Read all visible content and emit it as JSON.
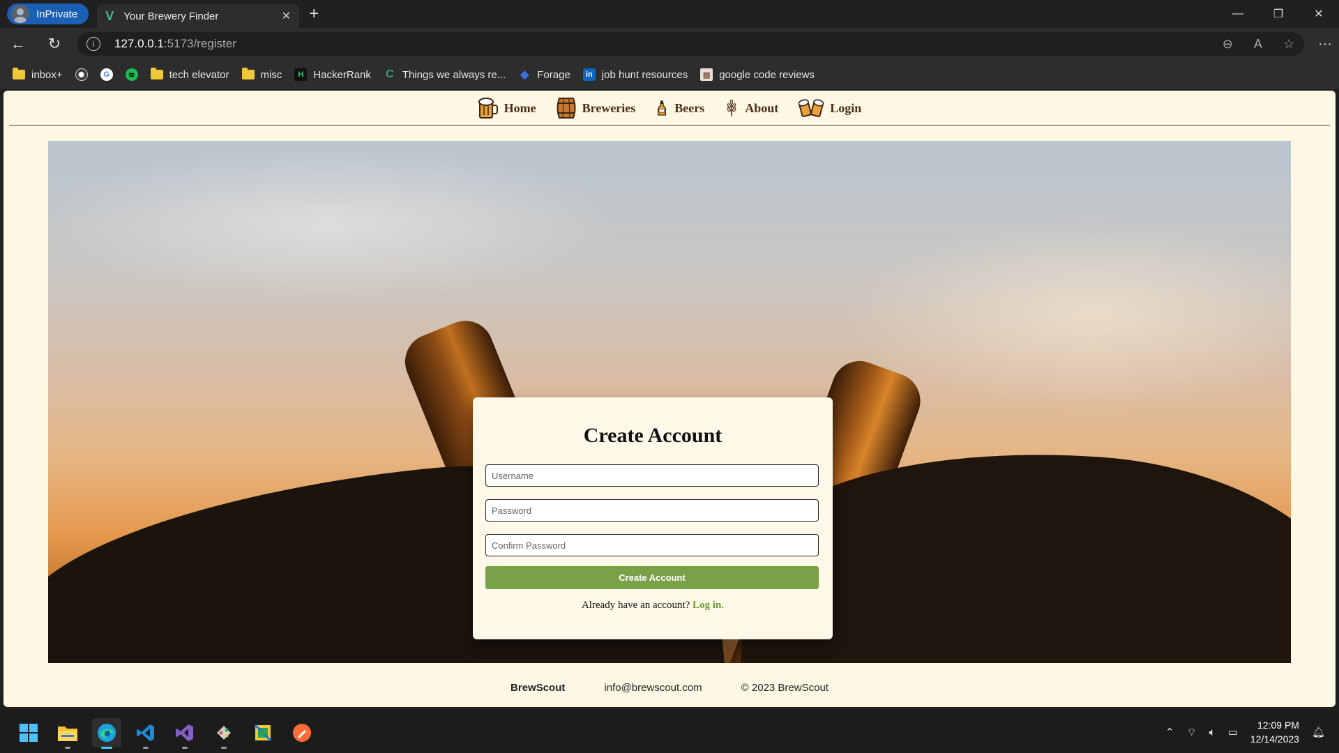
{
  "browser": {
    "profile_label": "InPrivate",
    "tab_title": "Your Brewery Finder",
    "url_host": "127.0.0.1",
    "url_path": ":5173/register",
    "bookmarks": [
      {
        "label": "inbox+",
        "icon": "folder-icon"
      },
      {
        "label": "",
        "icon": "chatgpt-icon"
      },
      {
        "label": "",
        "icon": "google-icon"
      },
      {
        "label": "",
        "icon": "spotify-icon"
      },
      {
        "label": "tech elevator",
        "icon": "folder-icon"
      },
      {
        "label": "misc",
        "icon": "folder-icon"
      },
      {
        "label": "HackerRank",
        "icon": "hackerrank-icon"
      },
      {
        "label": "Things we always re...",
        "icon": "site-icon"
      },
      {
        "label": "Forage",
        "icon": "forage-icon"
      },
      {
        "label": "job hunt resources",
        "icon": "linkedin-icon"
      },
      {
        "label": "google code reviews",
        "icon": "page-icon"
      }
    ]
  },
  "site_nav": {
    "items": [
      {
        "label": "Home",
        "icon": "beer-mug-icon"
      },
      {
        "label": "Breweries",
        "icon": "barrel-icon"
      },
      {
        "label": "Beers",
        "icon": "beer-bottle-icon"
      },
      {
        "label": "About",
        "icon": "wheat-icon"
      },
      {
        "label": "Login",
        "icon": "cheers-icon"
      }
    ]
  },
  "register": {
    "title": "Create Account",
    "username_placeholder": "Username",
    "password_placeholder": "Password",
    "confirm_placeholder": "Confirm Password",
    "submit_label": "Create Account",
    "already_text": "Already have an account?",
    "login_link": "Log in."
  },
  "footer": {
    "brand": "BrewScout",
    "email": "info@brewscout.com",
    "copyright": "© 2023 BrewScout"
  },
  "taskbar": {
    "time": "12:09 PM",
    "date": "12/14/2023"
  },
  "colors": {
    "page_bg": "#fdf8e4",
    "brand_brown": "#4a2e1a",
    "button_green": "#7ba148",
    "link_green": "#6f9a3c"
  }
}
